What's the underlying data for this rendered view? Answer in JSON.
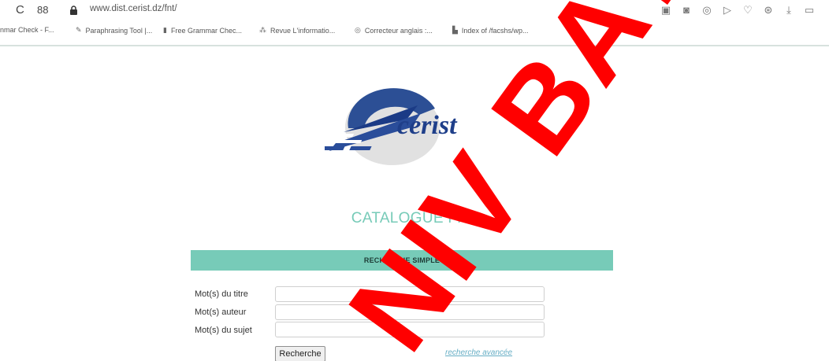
{
  "browser": {
    "url": "www.dist.cerist.dz/fnt/",
    "icons": [
      "reload-icon",
      "tab-grid-icon",
      "lock-icon"
    ],
    "toolbar_icons": [
      "reader-icon",
      "screenshot-icon",
      "record-icon",
      "play-icon",
      "heart-icon",
      "cube-icon",
      "download-icon",
      "battery-icon"
    ]
  },
  "bookmarks": [
    {
      "label": "nmar Check - F...",
      "icon": ""
    },
    {
      "label": "Paraphrasing Tool |...",
      "icon": "✎"
    },
    {
      "label": "Free Grammar Chec...",
      "icon": "▮"
    },
    {
      "label": "Revue L'informatio...",
      "icon": "⁂"
    },
    {
      "label": "Correcteur anglais :...",
      "icon": "◎"
    },
    {
      "label": "Index of /facshs/wp...",
      "icon": "▙"
    }
  ],
  "page": {
    "logo_text": "cerist",
    "title": "CATALOGUE FNT",
    "search_header": "RECHERCHE SIMPLE",
    "fields": [
      {
        "label": "Mot(s) du titre",
        "value": ""
      },
      {
        "label": "Mot(s) auteur",
        "value": ""
      },
      {
        "label": "Mot(s) du sujet",
        "value": ""
      }
    ],
    "search_button": "Recherche",
    "advanced_link": "recherche avancée"
  },
  "watermark": {
    "text": "NIV BAT",
    "color": "#ff0000"
  }
}
